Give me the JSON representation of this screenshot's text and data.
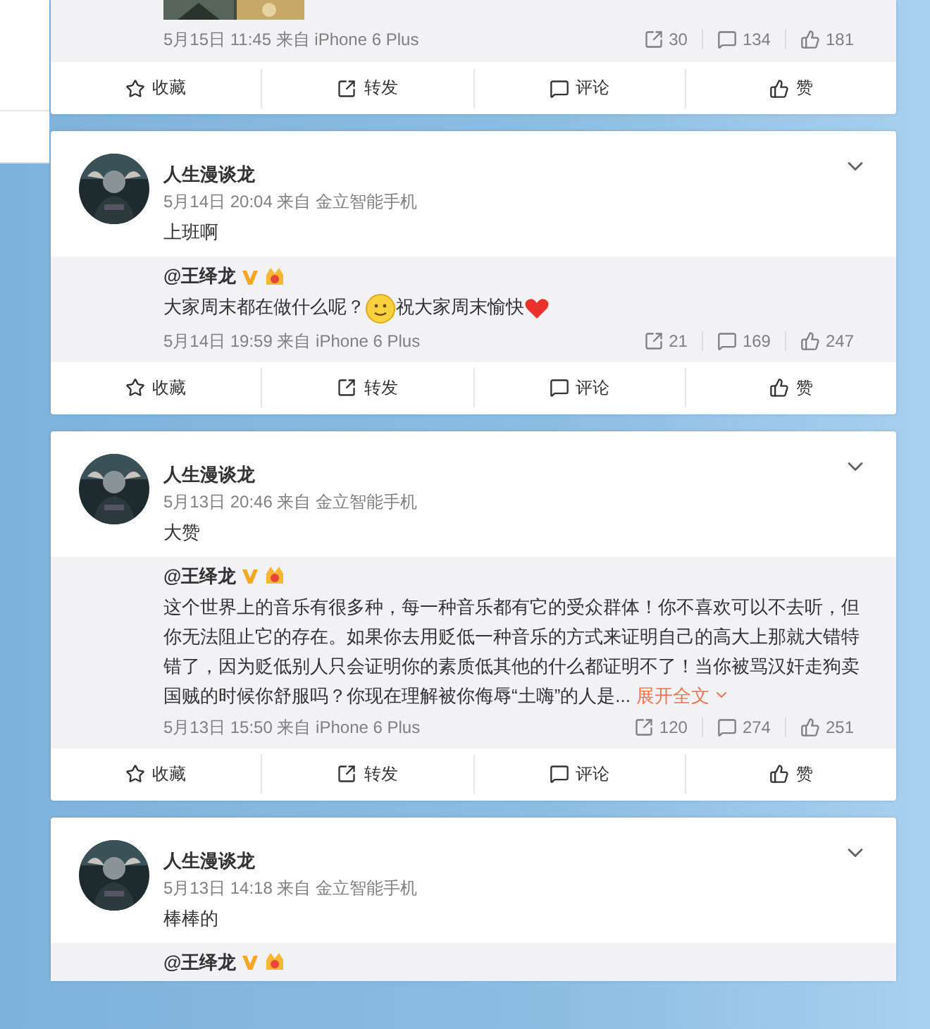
{
  "top_post": {
    "repost": {
      "date": "5月15日 11:45 来自 iPhone 6 Plus",
      "stats": {
        "shares": "30",
        "comments": "134",
        "likes": "181"
      }
    },
    "actions": [
      "收藏",
      "转发",
      "评论",
      "赞"
    ]
  },
  "posts": [
    {
      "author": "人生漫谈龙",
      "date": "5月14日 20:04 来自 金立智能手机",
      "text": "上班啊",
      "repost": {
        "author": "@王绎龙",
        "parts": [
          {
            "kind": "text",
            "text": "大家周末都在做什么呢？"
          },
          {
            "kind": "smiley"
          },
          {
            "kind": "text",
            "text": "祝大家周末愉快"
          },
          {
            "kind": "heart"
          }
        ],
        "date": "5月14日 19:59 来自 iPhone 6 Plus",
        "stats": {
          "shares": "21",
          "comments": "169",
          "likes": "247"
        }
      },
      "actions": [
        "收藏",
        "转发",
        "评论",
        "赞"
      ]
    },
    {
      "author": "人生漫谈龙",
      "date": "5月13日 20:46 来自 金立智能手机",
      "text": "大赞",
      "repost": {
        "author": "@王绎龙",
        "parts": [
          {
            "kind": "text",
            "text": "这个世界上的音乐有很多种，每一种音乐都有它的受众群体！你不喜欢可以不去听，但你无法阻止它的存在。如果你去用贬低一种音乐的方式来证明自己的高大上那就大错特错了，因为贬低别人只会证明你的素质低其他的什么都证明不了！当你被骂汉奸走狗卖国贼的时候你舒服吗？你现在理解被你侮辱“土嗨”的人是..."
          },
          {
            "kind": "link",
            "text": "展开全文"
          }
        ],
        "date": "5月13日 15:50 来自 iPhone 6 Plus",
        "stats": {
          "shares": "120",
          "comments": "274",
          "likes": "251"
        }
      },
      "actions": [
        "收藏",
        "转发",
        "评论",
        "赞"
      ]
    },
    {
      "author": "人生漫谈龙",
      "date": "5月13日 14:18 来自 金立智能手机",
      "text": "棒棒的",
      "repost": {
        "author": "@王绎龙"
      }
    }
  ]
}
